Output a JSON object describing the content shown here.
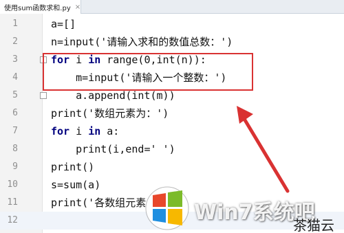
{
  "tab": {
    "title": "使用sum函数求和.py",
    "close_glyph": "×"
  },
  "lines": [
    {
      "num": "1",
      "code": "a=[]"
    },
    {
      "num": "2",
      "code": "n=input('请输入求和的数值总数：')"
    },
    {
      "num": "3",
      "kw": "for",
      "code": " i ",
      "kw2": "in",
      "rest": " range(0,int(n)):"
    },
    {
      "num": "4",
      "code": "    m=input('请输入一个整数：')"
    },
    {
      "num": "5",
      "code": "    a.append(int(m))"
    },
    {
      "num": "6",
      "code": "print('数组元素为：')"
    },
    {
      "num": "7",
      "kw": "for",
      "code": " i ",
      "kw2": "in",
      "rest": " a:"
    },
    {
      "num": "8",
      "code": "    print(i,end=' ')"
    },
    {
      "num": "9",
      "code": "print()"
    },
    {
      "num": "10",
      "code": "s=sum(a)"
    },
    {
      "num": "11",
      "code": "print('各数组元素"
    },
    {
      "num": "12",
      "code": ""
    }
  ],
  "watermark": {
    "text": "Win7系统吧"
  },
  "corner": {
    "text": "茶猫云"
  },
  "colors": {
    "highlight": "#d93232",
    "arrow": "#d93232",
    "keyword": "#00007f"
  }
}
